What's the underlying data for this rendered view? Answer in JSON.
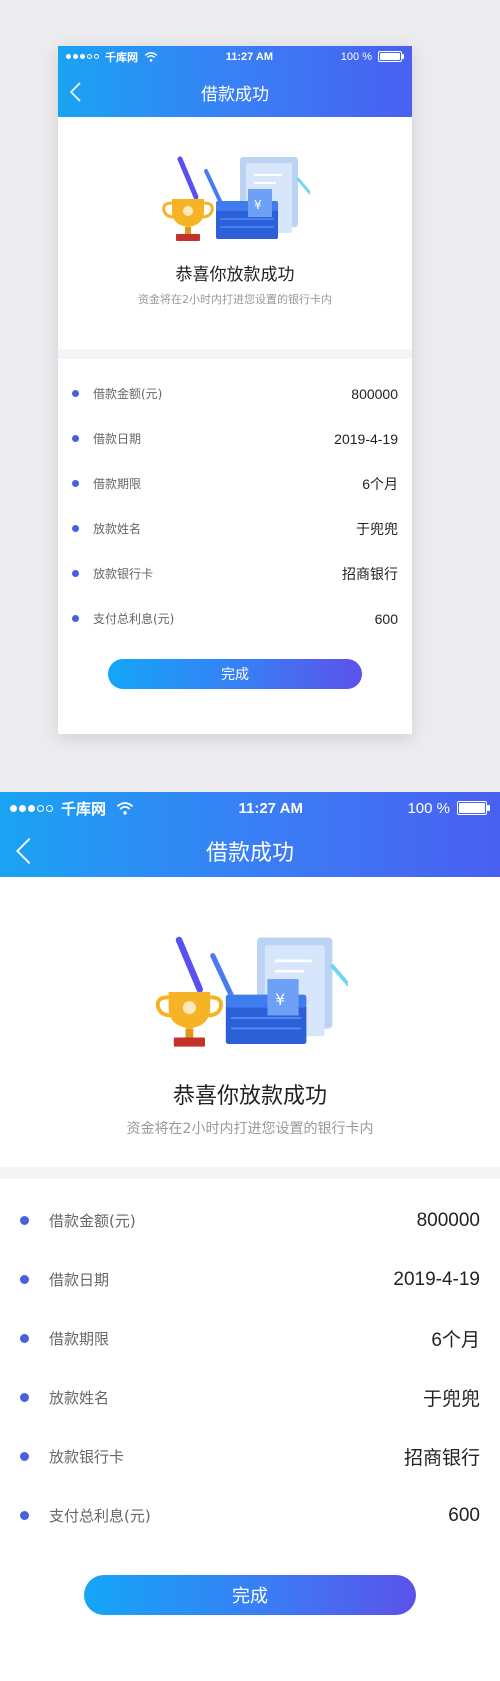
{
  "status_bar": {
    "carrier": "千库网",
    "time": "11:27 AM",
    "battery": "100 %",
    "battery_level": 1.0
  },
  "nav": {
    "title": "借款成功"
  },
  "hero": {
    "title": "恭喜你放款成功",
    "subtitle": "资金将在2小时内打进您设置的银行卡内"
  },
  "details": [
    {
      "label": "借款金额(元)",
      "value": "800000"
    },
    {
      "label": "借款日期",
      "value": "2019-4-19"
    },
    {
      "label": "借款期限",
      "value": "6个月"
    },
    {
      "label": "放款姓名",
      "value": "于兜兜"
    },
    {
      "label": "放款银行卡",
      "value": "招商银行"
    },
    {
      "label": "支付总利息(元)",
      "value": "600"
    }
  ],
  "actions": {
    "done_label": "完成"
  },
  "icons": [
    "signal-dots-icon",
    "wifi-icon",
    "battery-icon",
    "back-arrow-icon",
    "trophy-icon",
    "cash-stack-icon",
    "receipt-icon"
  ],
  "colors": {
    "brand_start": "#1aa3f3",
    "brand_end": "#4960f1",
    "bullet": "#4a5fe0"
  }
}
